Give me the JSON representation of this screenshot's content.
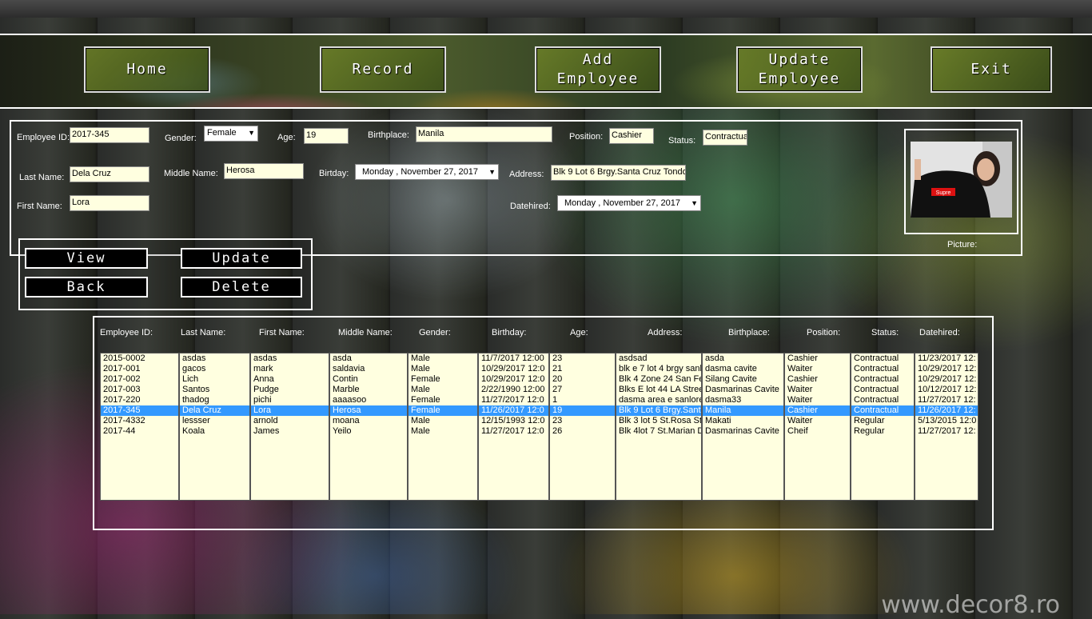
{
  "nav": {
    "home": "Home",
    "record": "Record",
    "add_employee_1": "Add",
    "add_employee_2": "Employee",
    "update_employee_1": "Update",
    "update_employee_2": "Employee",
    "exit": "Exit"
  },
  "form": {
    "employee_id_label": "Employee ID:",
    "employee_id": "2017-345",
    "gender_label": "Gender:",
    "gender": "Female",
    "age_label": "Age:",
    "age": "19",
    "birthplace_label": "Birthplace:",
    "birthplace": "Manila",
    "position_label": "Position:",
    "position": "Cashier",
    "status_label": "Status:",
    "status": "Contractua",
    "last_name_label": "Last Name:",
    "last_name": "Dela Cruz",
    "middle_name_label": "Middle Name:",
    "middle_name": "Herosa",
    "birthday_label": "Birtday:",
    "birthday_day": "Monday",
    "birthday_date": ", November 27, 2017",
    "address_label": "Address:",
    "address": "Blk 9 Lot 6 Brgy.Santa Cruz Tondo",
    "first_name_label": "First Name:",
    "first_name": "Lora",
    "datehired_label": "Datehired:",
    "datehired_day": "Monday",
    "datehired_date": ", November 27, 2017",
    "picture_label": "Picture:",
    "photo_shirt_text": "Supre"
  },
  "actions": {
    "view": "View",
    "update": "Update",
    "back": "Back",
    "delete": "Delete"
  },
  "table": {
    "headers": [
      "Employee ID:",
      "Last Name:",
      "First Name:",
      "Middle Name:",
      "Gender:",
      "Birthday:",
      "Age:",
      "Address:",
      "Birthplace:",
      "Position:",
      "Status:",
      "Datehired:"
    ],
    "selected_index": 5,
    "columns": [
      [
        "2015-0002",
        "2017-001",
        "2017-002",
        "2017-003",
        "2017-220",
        "2017-345",
        "2017-4332",
        "2017-44"
      ],
      [
        "asdas",
        "gacos",
        "Lich",
        "Santos",
        "thadog",
        "Dela Cruz",
        "lessser",
        "Koala"
      ],
      [
        "asdas",
        "mark",
        "Anna",
        "Pudge",
        "pichi",
        "Lora",
        "arnold",
        "James"
      ],
      [
        "asda",
        "saldavia",
        "Contin",
        "Marble",
        "aaaasoo",
        "Herosa",
        "moana",
        "Yeilo"
      ],
      [
        "Male",
        "Male",
        "Female",
        "Male",
        "Female",
        "Female",
        "Male",
        "Male"
      ],
      [
        "11/7/2017 12:00",
        "10/29/2017 12:0",
        "10/29/2017 12:0",
        "2/22/1990 12:00",
        "11/27/2017 12:0",
        "11/26/2017 12:0",
        "12/15/1993 12:0",
        "11/27/2017 12:0"
      ],
      [
        "23",
        "21",
        "20",
        "27",
        "1",
        "19",
        "23",
        "26"
      ],
      [
        "asdsad",
        "blk e 7 lot 4 brgy sanlo",
        "Blk 4 Zone 24 San Fe",
        "Blks E lot 44 LA Stree",
        "dasma area e sanlorer",
        "Blk 9 Lot 6 Brgy.Santa",
        "Blk 3 lot 5 St.Rosa St",
        "Blk 4lot 7 St.Marian D"
      ],
      [
        "asda",
        "dasma cavite",
        "Silang Cavite",
        "Dasmarinas Cavite",
        "dasma33",
        "Manila",
        "Makati",
        "Dasmarinas Cavite"
      ],
      [
        "Cashier",
        "Waiter",
        "Cashier",
        "Waiter",
        "Waiter",
        "Cashier",
        "Waiter",
        "Cheif"
      ],
      [
        "Contractual",
        "Contractual",
        "Contractual",
        "Contractual",
        "Contractual",
        "Contractual",
        "Regular",
        "Regular"
      ],
      [
        "11/23/2017 12:",
        "10/29/2017 12:",
        "10/29/2017 12:",
        "10/12/2017 12:",
        "11/27/2017 12:",
        "11/26/2017 12:",
        "5/13/2015 12:0",
        "11/27/2017 12:"
      ]
    ]
  },
  "watermark": "www.decor8.ro",
  "colors": {
    "field_bg": "#ffffe0",
    "selection": "#3399ff",
    "button_bg": "#000000"
  }
}
